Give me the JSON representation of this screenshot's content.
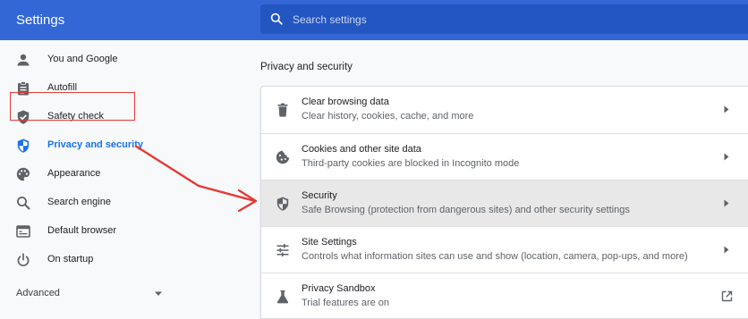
{
  "header": {
    "title": "Settings"
  },
  "search": {
    "placeholder": "Search settings",
    "icon": "search-icon"
  },
  "sidebar": {
    "items": [
      {
        "label": "You and Google",
        "icon": "person-icon"
      },
      {
        "label": "Autofill",
        "icon": "clipboard-icon"
      },
      {
        "label": "Safety check",
        "icon": "shield-check-icon"
      },
      {
        "label": "Privacy and security",
        "icon": "shield-icon",
        "selected": true
      },
      {
        "label": "Appearance",
        "icon": "palette-icon"
      },
      {
        "label": "Search engine",
        "icon": "search-icon"
      },
      {
        "label": "Default browser",
        "icon": "browser-icon"
      },
      {
        "label": "On startup",
        "icon": "power-icon"
      }
    ],
    "advanced": {
      "label": "Advanced"
    }
  },
  "main": {
    "section_title": "Privacy and security",
    "rows": [
      {
        "title": "Clear browsing data",
        "subtitle": "Clear history, cookies, cache, and more",
        "icon": "trash-icon"
      },
      {
        "title": "Cookies and other site data",
        "subtitle": "Third-party cookies are blocked in Incognito mode",
        "icon": "cookie-icon"
      },
      {
        "title": "Security",
        "subtitle": "Safe Browsing (protection from dangerous sites) and other security settings",
        "icon": "shield-icon",
        "active": true
      },
      {
        "title": "Site Settings",
        "subtitle": "Controls what information sites can use and show (location, camera, pop-ups, and more)",
        "icon": "tune-icon"
      },
      {
        "title": "Privacy Sandbox",
        "subtitle": "Trial features are on",
        "icon": "flask-icon",
        "external": true
      }
    ]
  },
  "colors": {
    "header": "#3367d6",
    "search_bar": "#2456c2",
    "accent": "#1a73e8",
    "annotation": "#e53935",
    "selected_row": "#e8e8e8"
  }
}
